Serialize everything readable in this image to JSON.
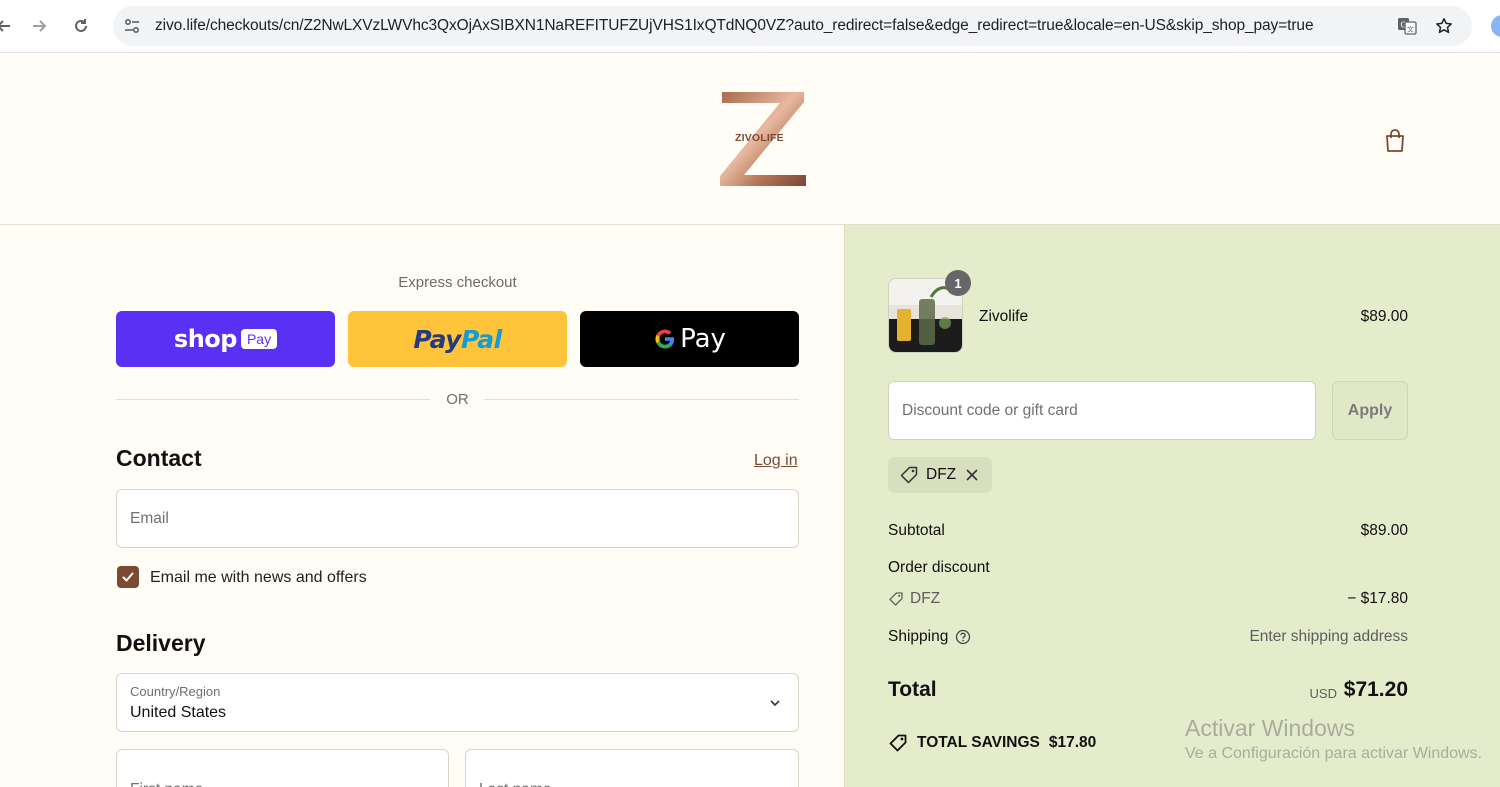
{
  "browser": {
    "url": "zivo.life/checkouts/cn/Z2NwLXVzLWVhc3QxOjAxSIBXN1NaREFITUFZUjVHS1IxQTdNQ0VZ?auto_redirect=false&edge_redirect=true&locale=en-US&skip_shop_pay=true"
  },
  "header": {
    "logo_text": "ZIVOLIFE"
  },
  "express": {
    "label": "Express checkout",
    "shop_word": "shop",
    "shop_chip": "Pay",
    "paypal_dark": "Pay",
    "paypal_light": "Pal",
    "gpay_word": "Pay",
    "or_text": "OR"
  },
  "contact": {
    "title": "Contact",
    "login_link": "Log in",
    "email_placeholder": "Email",
    "newsletter_label": "Email me with news and offers",
    "newsletter_checked": true
  },
  "delivery": {
    "title": "Delivery",
    "country_label": "Country/Region",
    "country_value": "United States",
    "first_name_placeholder": "First name",
    "last_name_placeholder": "Last name"
  },
  "summary": {
    "item": {
      "name": "Zivolife",
      "price": "$89.00",
      "quantity": "1"
    },
    "discount_placeholder": "Discount code or gift card",
    "apply_label": "Apply",
    "applied_code": "DFZ",
    "subtotal_label": "Subtotal",
    "subtotal_value": "$89.00",
    "order_discount_label": "Order discount",
    "order_discount_code": "DFZ",
    "order_discount_value": "− $17.80",
    "shipping_label": "Shipping",
    "shipping_value": "Enter shipping address",
    "total_label": "Total",
    "total_currency": "USD",
    "total_value": "$71.20",
    "savings_label": "TOTAL SAVINGS",
    "savings_value": "$17.80"
  },
  "watermark": {
    "line1": "Activar Windows",
    "line2": "Ve a Configuración para activar Windows."
  },
  "colors": {
    "shop_pay": "#5a31f4",
    "paypal": "#ffc439",
    "gpay": "#000000",
    "accent": "#7a4a33",
    "summary_bg": "#e4eccb"
  }
}
